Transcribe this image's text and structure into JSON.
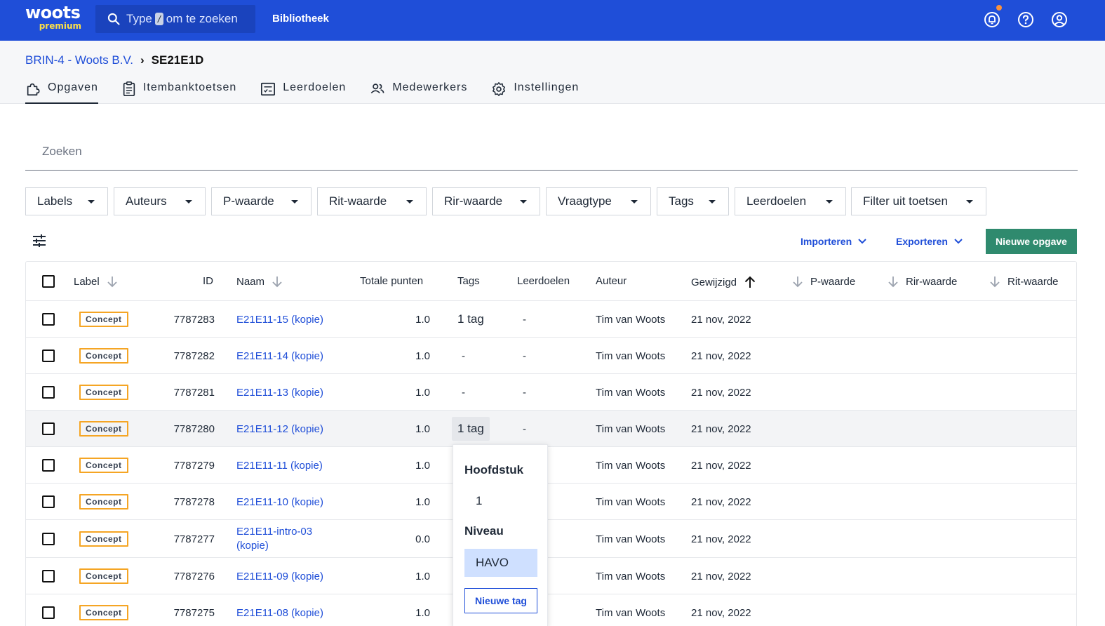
{
  "brand": {
    "name": "woots",
    "edition": "premium"
  },
  "topbar": {
    "search_prefix": "Type",
    "search_key": "/",
    "search_suffix": "om te zoeken",
    "library_label": "Bibliotheek"
  },
  "breadcrumb": {
    "parent": "BRIN-4 - Woots B.V.",
    "current": "SE21E1D"
  },
  "tabs": [
    {
      "label": "Opgaven",
      "icon": "puzzle-icon"
    },
    {
      "label": "Itembanktoetsen",
      "icon": "clipboard-icon"
    },
    {
      "label": "Leerdoelen",
      "icon": "checklist-icon"
    },
    {
      "label": "Medewerkers",
      "icon": "users-icon"
    },
    {
      "label": "Instellingen",
      "icon": "gear-icon"
    }
  ],
  "search": {
    "placeholder": "Zoeken"
  },
  "filters": [
    "Labels",
    "Auteurs",
    "P-waarde",
    "Rit-waarde",
    "Rir-waarde",
    "Vraagtype",
    "Tags",
    "Leerdoelen",
    "Filter uit toetsen"
  ],
  "toolbar": {
    "import_label": "Importeren",
    "export_label": "Exporteren",
    "new_label": "Nieuwe opgave"
  },
  "columns": {
    "label": "Label",
    "id": "ID",
    "name": "Naam",
    "points": "Totale punten",
    "tags": "Tags",
    "goals": "Leerdoelen",
    "author": "Auteur",
    "modified": "Gewijzigd",
    "p_value": "P-waarde",
    "rir_value": "Rir-waarde",
    "rit_value": "Rit-waarde"
  },
  "rows": [
    {
      "label": "Concept",
      "id": "7787283",
      "name": "E21E11-15 (kopie)",
      "points": "1.0",
      "tags": "1 tag",
      "goals": "-",
      "author": "Tim van Woots",
      "modified": "21 nov, 2022"
    },
    {
      "label": "Concept",
      "id": "7787282",
      "name": "E21E11-14 (kopie)",
      "points": "1.0",
      "tags": "-",
      "goals": "-",
      "author": "Tim van Woots",
      "modified": "21 nov, 2022"
    },
    {
      "label": "Concept",
      "id": "7787281",
      "name": "E21E11-13 (kopie)",
      "points": "1.0",
      "tags": "-",
      "goals": "-",
      "author": "Tim van Woots",
      "modified": "21 nov, 2022"
    },
    {
      "label": "Concept",
      "id": "7787280",
      "name": "E21E11-12 (kopie)",
      "points": "1.0",
      "tags": "1 tag",
      "goals": "-",
      "author": "Tim van Woots",
      "modified": "21 nov, 2022"
    },
    {
      "label": "Concept",
      "id": "7787279",
      "name": "E21E11-11 (kopie)",
      "points": "1.0",
      "tags": "",
      "goals": "",
      "author": "Tim van Woots",
      "modified": "21 nov, 2022"
    },
    {
      "label": "Concept",
      "id": "7787278",
      "name": "E21E11-10 (kopie)",
      "points": "1.0",
      "tags": "",
      "goals": "",
      "author": "Tim van Woots",
      "modified": "21 nov, 2022"
    },
    {
      "label": "Concept",
      "id": "7787277",
      "name": "E21E11-intro-03 (kopie)",
      "name_line1": "E21E11-intro-03",
      "name_line2": "(kopie)",
      "points": "0.0",
      "tags": "",
      "goals": "",
      "author": "Tim van Woots",
      "modified": "21 nov, 2022"
    },
    {
      "label": "Concept",
      "id": "7787276",
      "name": "E21E11-09 (kopie)",
      "points": "1.0",
      "tags": "",
      "goals": "",
      "author": "Tim van Woots",
      "modified": "21 nov, 2022"
    },
    {
      "label": "Concept",
      "id": "7787275",
      "name": "E21E11-08 (kopie)",
      "points": "1.0",
      "tags": "",
      "goals": "",
      "author": "Tim van Woots",
      "modified": "21 nov, 2022"
    }
  ],
  "tag_popover": {
    "group1_title": "Hoofdstuk",
    "group1_value": "1",
    "group2_title": "Niveau",
    "group2_value": "HAVO",
    "new_tag_label": "Nieuwe tag"
  }
}
